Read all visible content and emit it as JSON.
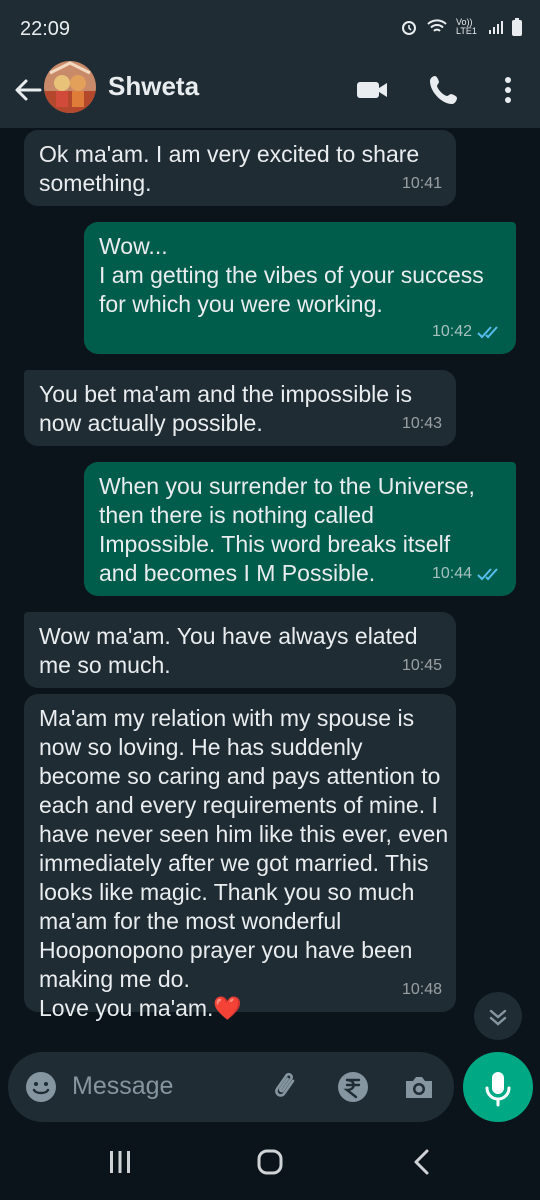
{
  "status_bar": {
    "time": "22:09",
    "network_label": "Vo)) LTE1"
  },
  "header": {
    "contact_name": "Shweta"
  },
  "messages": [
    {
      "direction": "in",
      "text": "Ok ma'am. I am very excited to share something.",
      "time": "10:41"
    },
    {
      "direction": "out",
      "text": "Wow...\nI am getting the vibes of your success for which you were working.",
      "time": "10:42",
      "status": "read"
    },
    {
      "direction": "in",
      "text": "You bet ma'am and the impossible is now actually possible.",
      "time": "10:43"
    },
    {
      "direction": "out",
      "text": "When you surrender to the Universe, then there is nothing called Impossible. This word breaks itself and becomes I M Possible.",
      "time": "10:44",
      "status": "read"
    },
    {
      "direction": "in",
      "text": "Wow ma'am. You have always elated me so much.",
      "time": "10:45"
    },
    {
      "direction": "in",
      "text": "Ma'am my relation with my spouse is now so loving. He has suddenly become so caring and pays attention to each and every requirements of mine. I have never seen him like this ever, even immediately after we got married. This looks like magic. Thank you so much ma'am for the most wonderful Hooponopono prayer you have been making me do.\nLove you ma'am.❤️",
      "time": "10:48"
    }
  ],
  "composer": {
    "placeholder": "Message"
  },
  "colors": {
    "incoming_bubble": "#202c33",
    "outgoing_bubble": "#005c4b",
    "accent": "#00a884",
    "read_ticks": "#53bdeb"
  },
  "icons": [
    "back-arrow-icon",
    "video-call-icon",
    "voice-call-icon",
    "more-options-icon",
    "scroll-down-icon",
    "emoji-icon",
    "attach-icon",
    "rupee-payment-icon",
    "camera-icon",
    "mic-icon"
  ]
}
